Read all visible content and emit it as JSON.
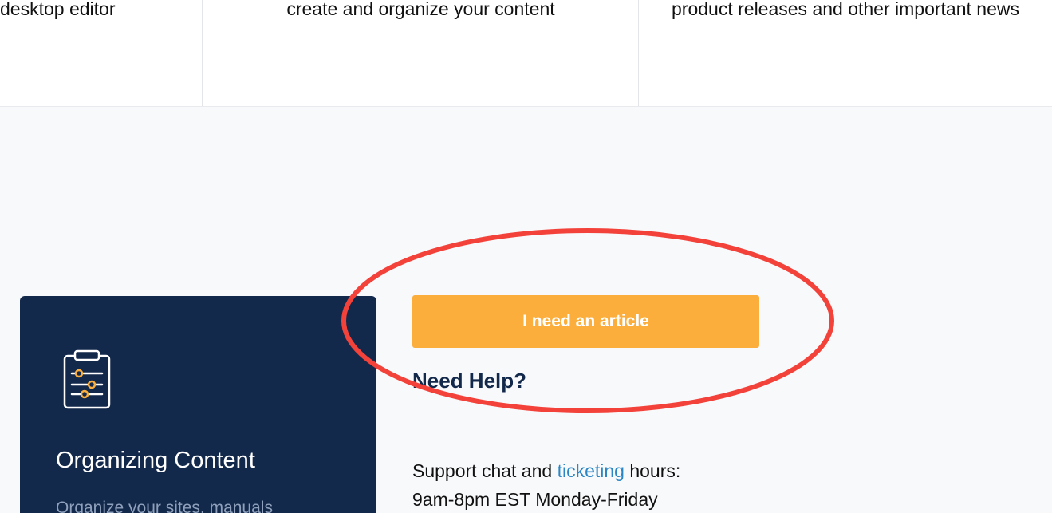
{
  "features": {
    "col1_text": "desktop editor",
    "col2_text": "create and organize your content",
    "col3_text": "product releases and other important news"
  },
  "card": {
    "icon": "clipboard-settings-icon",
    "title": "Organizing Content",
    "description": "Organize your sites, manuals"
  },
  "help": {
    "button_label": "I need an article",
    "title": "Need Help?",
    "hours_prefix": "Support chat and ",
    "hours_link": "ticketing",
    "hours_suffix": " hours:",
    "hours_schedule": "9am-8pm EST Monday-Friday"
  },
  "colors": {
    "card_bg": "#13294b",
    "button_bg": "#fbae3c",
    "link": "#2b86c5",
    "annotation": "#f3423a"
  }
}
